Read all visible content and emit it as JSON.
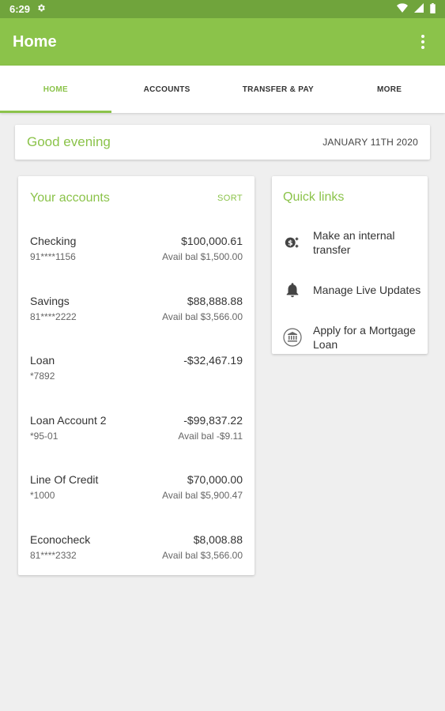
{
  "status_bar": {
    "time": "6:29",
    "icons": [
      "gear-icon",
      "wifi-icon",
      "signal-icon",
      "battery-icon"
    ]
  },
  "app_bar": {
    "title": "Home",
    "menu_icon": "overflow-menu-icon"
  },
  "tabs": [
    {
      "label": "HOME",
      "active": true
    },
    {
      "label": "ACCOUNTS",
      "active": false
    },
    {
      "label": "TRANSFER & PAY",
      "active": false
    },
    {
      "label": "MORE",
      "active": false
    }
  ],
  "greeting": {
    "text": "Good evening",
    "date": "JANUARY 11TH 2020"
  },
  "accounts": {
    "title": "Your accounts",
    "sort_label": "SORT",
    "items": [
      {
        "name": "Checking",
        "number": "91****1156",
        "balance": "$100,000.61",
        "avail": "Avail bal $1,500.00"
      },
      {
        "name": "Savings",
        "number": "81****2222",
        "balance": "$88,888.88",
        "avail": "Avail bal $3,566.00"
      },
      {
        "name": "Loan",
        "number": "*7892",
        "balance": "-$32,467.19",
        "avail": ""
      },
      {
        "name": "Loan Account 2",
        "number": "*95-01",
        "balance": "-$99,837.22",
        "avail": "Avail bal -$9.11"
      },
      {
        "name": "Line Of Credit",
        "number": "*1000",
        "balance": "$70,000.00",
        "avail": "Avail bal $5,900.47"
      },
      {
        "name": "Econocheck",
        "number": "81****2332",
        "balance": "$8,008.88",
        "avail": "Avail bal $3,566.00"
      }
    ]
  },
  "quick_links": {
    "title": "Quick links",
    "items": [
      {
        "label": "Make an internal transfer",
        "icon": "transfer-icon"
      },
      {
        "label": "Manage Live Updates",
        "icon": "bell-icon"
      },
      {
        "label": "Apply for a Mortgage Loan",
        "icon": "bank-icon"
      }
    ]
  },
  "colors": {
    "status_bar": "#70a43c",
    "primary": "#8bc34a",
    "background": "#efefef"
  }
}
